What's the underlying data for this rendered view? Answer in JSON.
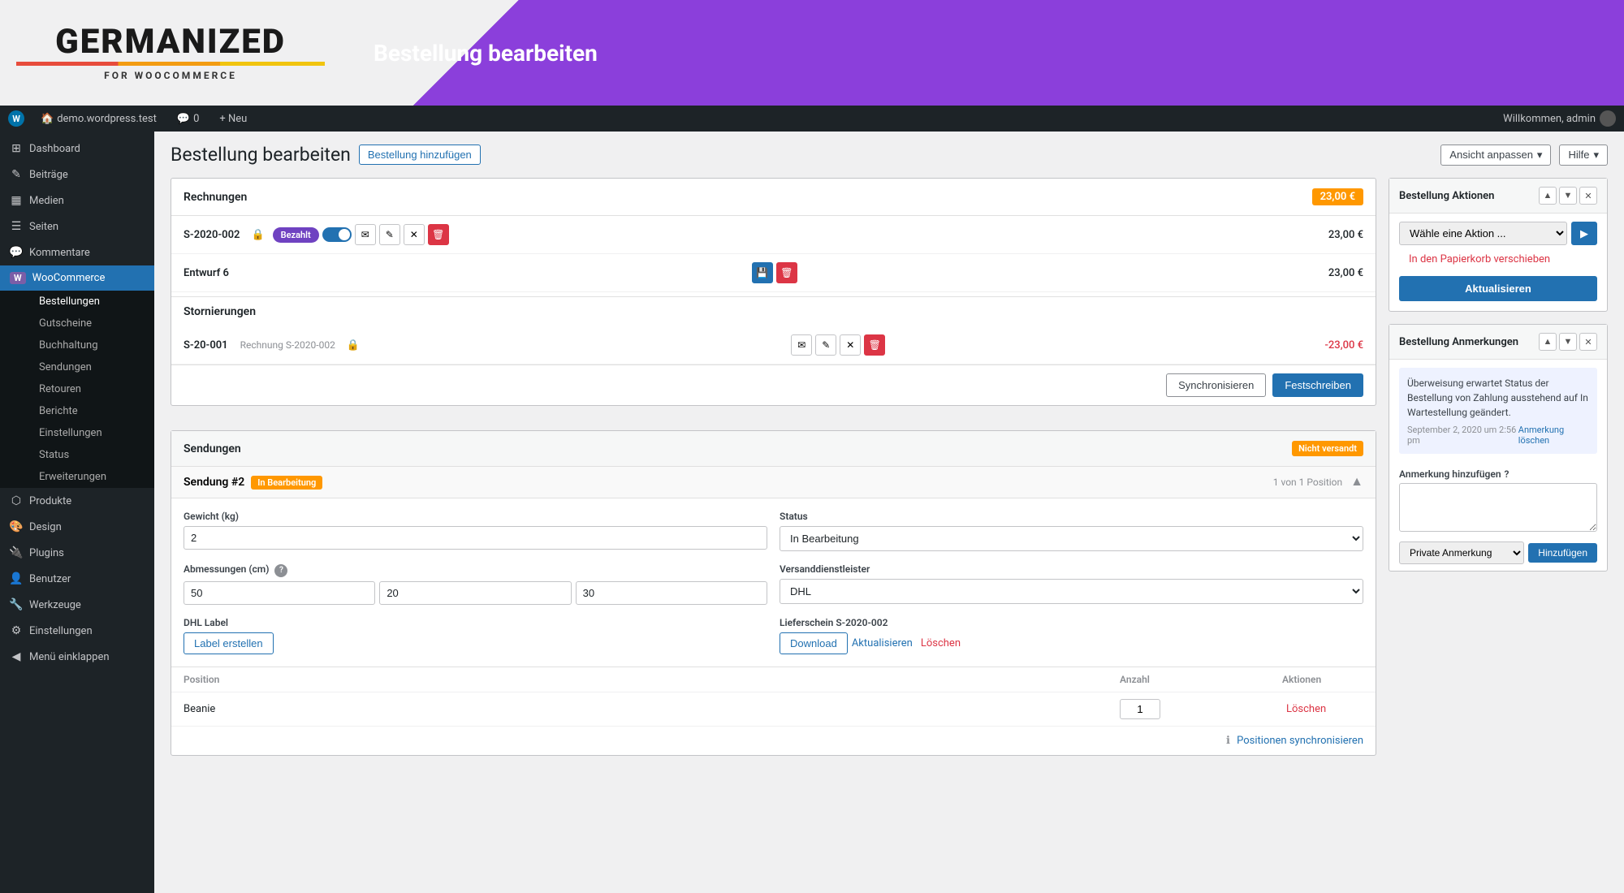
{
  "banner": {
    "logo_text": "GERMANIZED",
    "logo_sub": "FOR WOOCOMMERCE",
    "title": "Bestellung bearbeiten"
  },
  "admin_bar": {
    "site": "demo.wordpress.test",
    "comments_count": "0",
    "new_label": "+ Neu",
    "welcome": "Willkommen, admin"
  },
  "toolbar": {
    "view_label": "Ansicht anpassen",
    "help_label": "Hilfe"
  },
  "page": {
    "title": "Bestellung bearbeiten",
    "add_button": "Bestellung hinzufügen"
  },
  "sidebar": {
    "items": [
      {
        "label": "Dashboard",
        "icon": "⊞"
      },
      {
        "label": "Beiträge",
        "icon": "✎"
      },
      {
        "label": "Medien",
        "icon": "▦"
      },
      {
        "label": "Seiten",
        "icon": "☰"
      },
      {
        "label": "Kommentare",
        "icon": "💬"
      },
      {
        "label": "WooCommerce",
        "icon": "W",
        "active": true
      },
      {
        "label": "Produkte",
        "icon": "⬡"
      },
      {
        "label": "Design",
        "icon": "🎨"
      },
      {
        "label": "Plugins",
        "icon": "🔌"
      },
      {
        "label": "Benutzer",
        "icon": "👤"
      },
      {
        "label": "Werkzeuge",
        "icon": "🔧"
      },
      {
        "label": "Einstellungen",
        "icon": "⚙"
      },
      {
        "label": "Menü einklappen",
        "icon": "◀"
      }
    ],
    "woo_sub": [
      {
        "label": "Bestellungen",
        "active": true
      },
      {
        "label": "Gutscheine"
      },
      {
        "label": "Buchhaltung"
      },
      {
        "label": "Sendungen"
      },
      {
        "label": "Retouren"
      },
      {
        "label": "Berichte"
      },
      {
        "label": "Einstellungen"
      },
      {
        "label": "Status"
      },
      {
        "label": "Erweiterungen"
      }
    ]
  },
  "rechnungen": {
    "title": "Rechnungen",
    "total_badge": "23,00 €",
    "invoice1": {
      "number": "S-2020-002",
      "status": "Bezahlt",
      "amount": "23,00 €"
    },
    "invoice2": {
      "number": "Entwurf 6",
      "amount": "23,00 €"
    },
    "stornierungen_title": "Stornierungen",
    "storno1": {
      "number": "S-20-001",
      "ref": "Rechnung S-2020-002",
      "amount": "-23,00 €"
    },
    "sync_btn": "Synchronisieren",
    "commit_btn": "Festschreiben"
  },
  "sendungen": {
    "title": "Sendungen",
    "status_badge": "Nicht versandt",
    "shipment_label": "Sendung #2",
    "shipment_status": "In Bearbeitung",
    "shipment_count": "1 von 1 Position",
    "weight_label": "Gewicht (kg)",
    "weight_value": "2",
    "status_label": "Status",
    "status_value": "In Bearbeitung",
    "dimensions_label": "Abmessungen (cm)",
    "dim1": "50",
    "dim2": "20",
    "dim3": "30",
    "carrier_label": "Versanddienstleister",
    "carrier_value": "DHL",
    "dhl_label_section": "DHL Label",
    "create_label_btn": "Label erstellen",
    "delivery_label": "Lieferschein S-2020-002",
    "download_btn": "Download",
    "update_link": "Aktualisieren",
    "delete_link": "Löschen",
    "positions_header_pos": "Position",
    "positions_header_qty": "Anzahl",
    "positions_header_actions": "Aktionen",
    "item_name": "Beanie",
    "item_qty": "1",
    "item_delete": "Löschen",
    "sync_positions": "Positionen synchronisieren"
  },
  "bestellung_aktionen": {
    "title": "Bestellung Aktionen",
    "select_placeholder": "Wähle eine Aktion ...",
    "trash_link": "In den Papierkorb verschieben",
    "update_btn": "Aktualisieren"
  },
  "anmerkungen": {
    "title": "Bestellung Anmerkungen",
    "note_text": "Überweisung erwartet Status der Bestellung von Zahlung ausstehend auf In Wartestellung geändert.",
    "note_time": "September 2, 2020 um 2:56 pm",
    "note_delete": "Anmerkung löschen",
    "add_label": "Anmerkung hinzufügen",
    "note_type": "Private Anmerkung",
    "add_btn": "Hinzufügen"
  }
}
